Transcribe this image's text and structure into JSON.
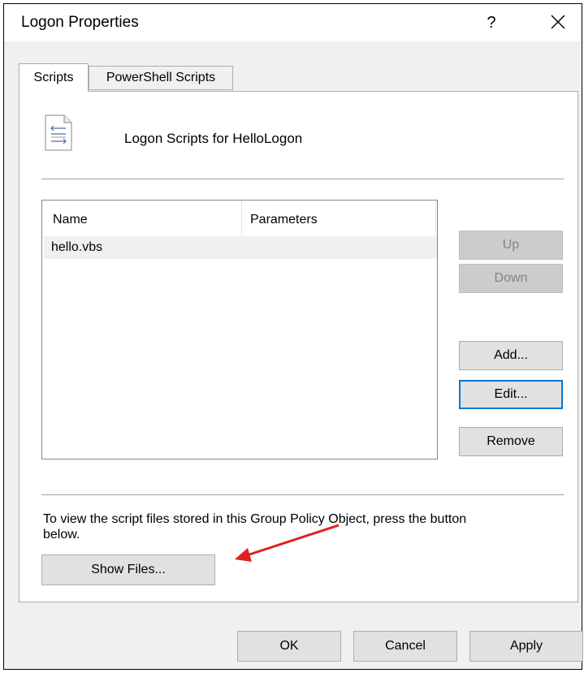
{
  "window": {
    "title": "Logon Properties",
    "help_label": "?"
  },
  "tabs": [
    {
      "label": "Scripts",
      "active": true
    },
    {
      "label": "PowerShell Scripts",
      "active": false
    }
  ],
  "header": {
    "text": "Logon Scripts for HelloLogon",
    "icon": "script-file-icon"
  },
  "list": {
    "columns": [
      "Name",
      "Parameters"
    ],
    "rows": [
      {
        "name": "hello.vbs",
        "parameters": ""
      }
    ]
  },
  "side_buttons": {
    "up": "Up",
    "down": "Down",
    "add": "Add...",
    "edit": "Edit...",
    "remove": "Remove"
  },
  "info_text": "To view the script files stored in this Group Policy Object, press the button below.",
  "show_files_label": "Show Files...",
  "footer": {
    "ok": "OK",
    "cancel": "Cancel",
    "apply": "Apply"
  },
  "colors": {
    "focus": "#0078d7",
    "annotation_arrow": "#e02020"
  }
}
